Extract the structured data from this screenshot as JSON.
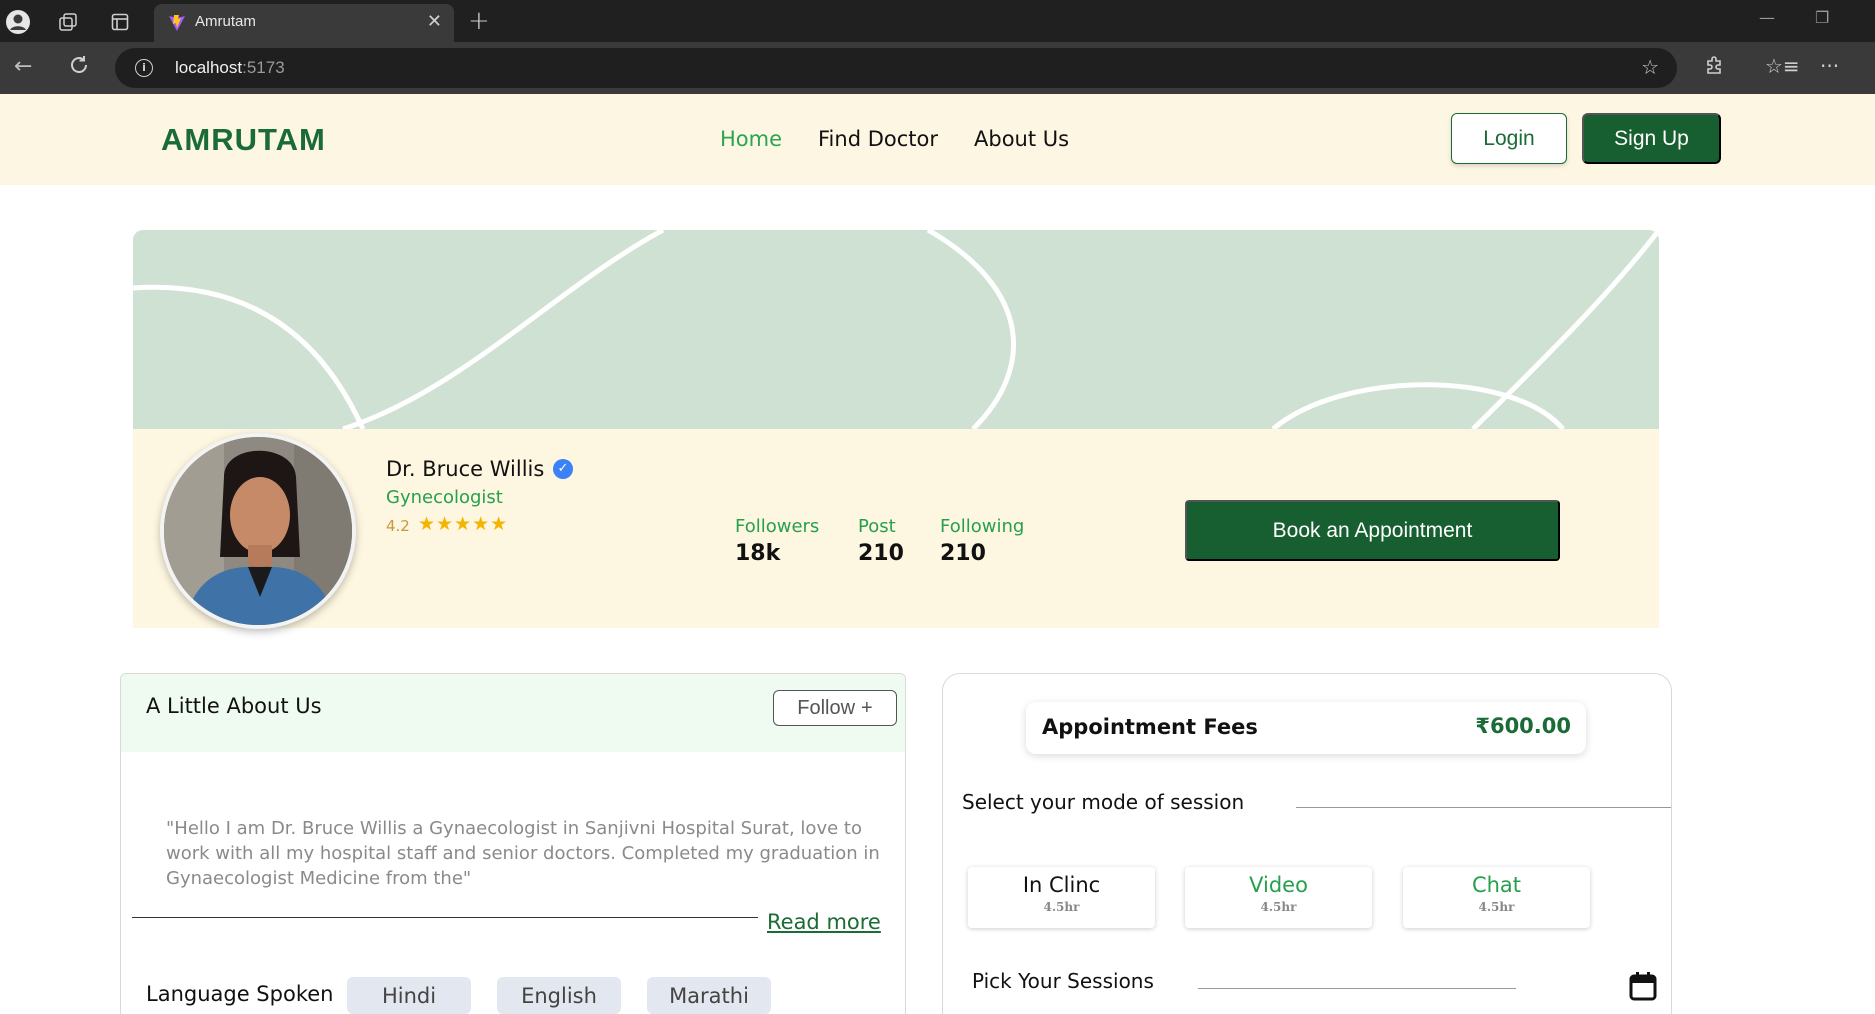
{
  "browser": {
    "tab_title": "Amrutam",
    "url_host": "localhost",
    "url_port": ":5173"
  },
  "site": {
    "logo": "AMRUTAM",
    "nav": [
      {
        "label": "Home",
        "active": true
      },
      {
        "label": "Find Doctor",
        "active": false
      },
      {
        "label": "About Us",
        "active": false
      }
    ],
    "login_label": "Login",
    "signup_label": "Sign Up"
  },
  "profile": {
    "name": "Dr. Bruce Willis",
    "specialty": "Gynecologist",
    "rating": "4.2",
    "stars": "★★★★★",
    "stats": [
      {
        "label": "Followers",
        "value": "18k"
      },
      {
        "label": "Post",
        "value": "210"
      },
      {
        "label": "Following",
        "value": "210"
      }
    ],
    "book_label": "Book an Appointment"
  },
  "about": {
    "title": "A Little About Us",
    "follow_label": "Follow",
    "text": "\"Hello I am Dr. Bruce Willis a Gynaecologist in Sanjivni Hospital Surat, love to work with all my hospital staff and senior doctors. Completed my graduation in Gynaecologist Medicine from the\"",
    "read_more": "Read more",
    "language_label": "Language Spoken",
    "languages": [
      "Hindi",
      "English",
      "Marathi"
    ]
  },
  "booking": {
    "fees_label": "Appointment Fees",
    "fees_value": "₹600.00",
    "mode_label": "Select your mode of session",
    "modes": [
      {
        "name": "In Clinc",
        "time": "4.5hr",
        "color": "#111111"
      },
      {
        "name": "Video",
        "time": "4.5hr",
        "color": "#27a04d"
      },
      {
        "name": "Chat",
        "time": "4.5hr",
        "color": "#27a04d"
      }
    ],
    "sessions_label": "Pick Your Sessions"
  },
  "colors": {
    "brand_green": "#175f30",
    "accent_green": "#27a04d",
    "header_bg": "#fdf6e3",
    "banner_bg": "#cfe1d3"
  },
  "icons": [
    "profile-icon",
    "workspaces-icon",
    "tab-actions-icon",
    "close-icon",
    "plus-icon",
    "back-icon",
    "refresh-icon",
    "info-icon",
    "star-icon",
    "extensions-icon",
    "favorites-icon",
    "more-icon",
    "verified-icon",
    "calendar-icon"
  ]
}
